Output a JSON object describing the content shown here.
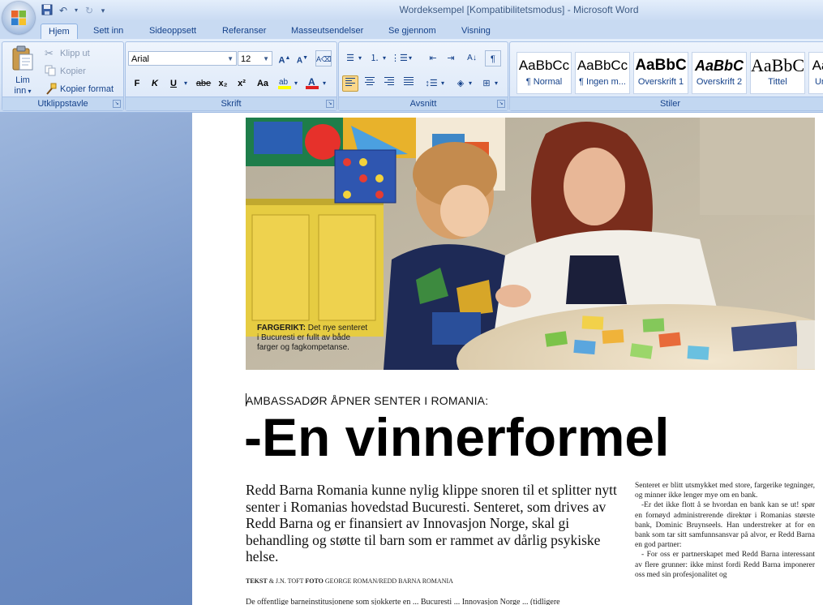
{
  "window": {
    "title": "Wordeksempel [Kompatibilitetsmodus] - Microsoft Word"
  },
  "quick_access": {
    "icons": [
      "save-icon",
      "undo-icon",
      "redo-icon",
      "customize-icon"
    ]
  },
  "tabs": [
    {
      "label": "Hjem",
      "active": true
    },
    {
      "label": "Sett inn"
    },
    {
      "label": "Sideoppsett"
    },
    {
      "label": "Referanser"
    },
    {
      "label": "Masseutsendelser"
    },
    {
      "label": "Se gjennom"
    },
    {
      "label": "Visning"
    }
  ],
  "ribbon": {
    "clipboard": {
      "paste_label_1": "Lim",
      "paste_label_2": "inn",
      "cut": "Klipp ut",
      "copy": "Kopier",
      "format_painter": "Kopier format",
      "group_label": "Utklippstavle"
    },
    "font": {
      "font_name": "Arial",
      "font_size": "12",
      "bold": "F",
      "italic": "K",
      "underline": "U",
      "strike": "abe",
      "subscript": "x₂",
      "superscript": "x²",
      "change_case": "Aa",
      "group_label": "Skrift"
    },
    "paragraph": {
      "group_label": "Avsnitt"
    },
    "styles": {
      "items": [
        {
          "sample": "AaBbCc",
          "name": "¶ Normal"
        },
        {
          "sample": "AaBbCc",
          "name": "¶ Ingen m..."
        },
        {
          "sample": "AaBbC",
          "name": "Overskrift 1"
        },
        {
          "sample": "AaBbC",
          "name": "Overskrift 2"
        },
        {
          "sample": "AaBbC",
          "name": "Tittel"
        },
        {
          "sample": "Aa",
          "name": "Un"
        }
      ],
      "group_label": "Stiler"
    }
  },
  "document": {
    "caption_bold": "FARGERIKT:",
    "caption_line1": " Det nye senteret",
    "caption_line2": "i Bucuresti er fullt av både",
    "caption_line3": "farger og fagkompetanse.",
    "kicker": "AMBASSADØR ÅPNER SENTER I ROMANIA:",
    "headline": "-En vinnerformel",
    "lead": "Redd Barna Romania kunne nylig klippe snoren til et splitter nytt senter i Romanias hovedstad Bucuresti. Senteret, som drives av Redd Barna og er finansiert av Innovasjon Norge, skal gi behandling og støtte til barn som er rammet av dårlig psykiske helse.",
    "credit_tekst": "TEKST",
    "credit_author": " & J.N. TOFT ",
    "credit_foto": "FOTO",
    "credit_photo": " GEORGE ROMAN/REDD BARNA ROMANIA",
    "body_start": "De offentlige barneinstitusjonene som sjokkerte en ... Bucuresti ... Innovasjon Norge ... (tidligere",
    "side_p1": "Senteret er blitt utsmykket med store, fargerike tegninger, og minner ikke lenger mye om en bank.",
    "side_p2": "-Er det ikke flott å se hvordan en bank kan se ut! spør en fornøyd administrerende direktør i Romanias største bank, Dominic Bruynseels. Han understreker at for en bank som tar sitt samfunnsansvar på alvor, er Redd Barna en god partner:",
    "side_p3": "- For oss er partnerskapet med Redd Barna interessant av flere grunner: ikke minst fordi Redd Barna imponerer oss med sin profesjonalitet og"
  }
}
